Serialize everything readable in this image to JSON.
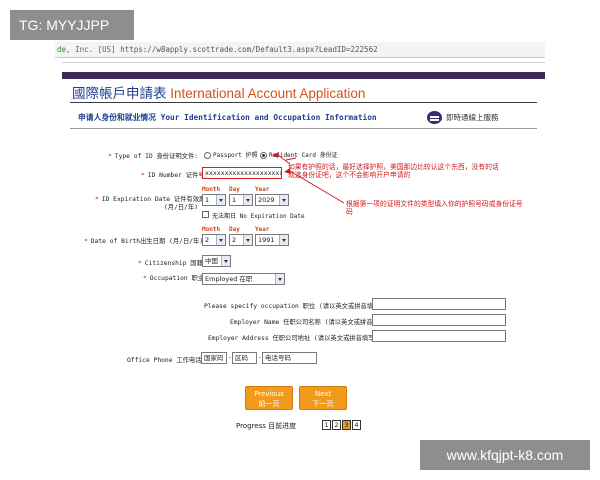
{
  "watermark_top": "TG: MYYJJPP",
  "watermark_bottom": "www.kfqjpt-k8.com",
  "urlbar": {
    "site": "de, Inc. [US]",
    "url": "https://w8apply.scottrade.com/Default3.aspx?LeadID=222562"
  },
  "page_title": {
    "cn": "國際帳戶申請表",
    "en": "International Account Application"
  },
  "section_title": "申请人身份和就业情况 Your Identification and Occupation Information",
  "chat_label": "即時通線上服務",
  "form": {
    "id_type_label": "Type of ID 身份证明文件:",
    "id_type_options": [
      "Passport 护照",
      "Resident Card 身份证"
    ],
    "id_number_label": "ID Number 证件号码",
    "id_number_value": "xxxxxxxxxxxxxxxxxxxx",
    "id_exp_label": "ID Expiration Date 证件有效期",
    "id_exp_sub": "(月/日/年)",
    "date_labels": {
      "month": "Month",
      "day": "Day",
      "year": "Year"
    },
    "id_exp": {
      "month": "1",
      "day": "1",
      "year": "2029"
    },
    "no_exp_label": "无法期日 No Expiration Date",
    "dob_label": "Date of Birth出生日期 (月/日/年)",
    "dob": {
      "month": "2",
      "day": "2",
      "year": "1991"
    },
    "citizenship_label": "Citizenship 国籍",
    "citizenship_value": "中国",
    "occupation_label": "Occupation 职业",
    "occupation_value": "Employed 在职",
    "spec_occ_label": "Please specify occupation 职位 (请以英文或拼音填写)",
    "employer_name_label": "Employer Name 任职公司名称 (请以英文或拼音填写)",
    "employer_addr_label": "Employer Address 任职公司地址 (请以英文或拼音填写)",
    "office_phone_label": "Office Phone 工作电话",
    "phone_country": "国家码",
    "phone_area": "区码",
    "phone_number": "电话号码"
  },
  "annotations": {
    "note1_line1": "如果有护照的话，最好选择护照，美国那边比较认这个东西，没有的话",
    "note1_line2": "就选身份证吧，这个不会影响开户申请的",
    "note2_line1": "根据第一项的证明文件的类型填入你的护照号码或身份证号",
    "note2_line2": "码"
  },
  "buttons": {
    "previous_en": "Previous",
    "previous_cn": "前一页",
    "next_en": "Next",
    "next_cn": "下一页"
  },
  "progress": {
    "label": "Progress 目前进度",
    "steps": [
      "1",
      "2",
      "3",
      "4"
    ],
    "current": 3
  }
}
